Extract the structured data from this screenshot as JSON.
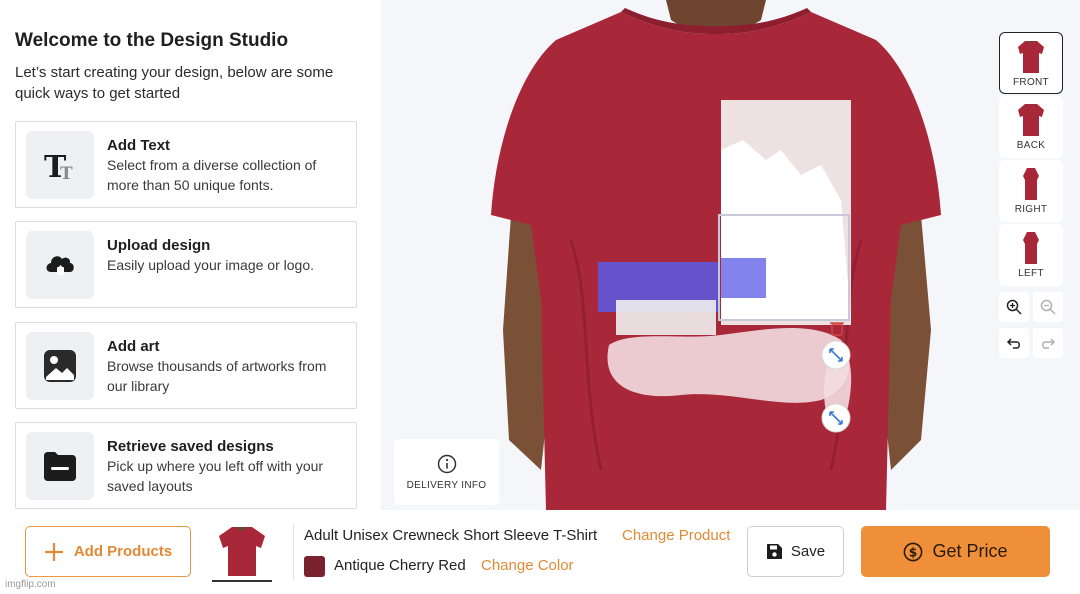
{
  "welcome": {
    "title": "Welcome to the Design Studio",
    "subtitle": "Let’s start creating your design, below are some quick ways to get started"
  },
  "options": [
    {
      "title": "Add Text",
      "description": "Select from a diverse collection of more than 50 unique fonts.",
      "icon": "text-icon"
    },
    {
      "title": "Upload design",
      "description": "Easily upload your image or logo.",
      "icon": "cloud-upload-icon"
    },
    {
      "title": "Add art",
      "description": "Browse thousands of artworks from our library",
      "icon": "image-icon"
    },
    {
      "title": "Retrieve saved designs",
      "description": "Pick up where you left off with your saved layouts",
      "icon": "folder-icon"
    }
  ],
  "views": {
    "front": "FRONT",
    "back": "BACK",
    "right": "RIGHT",
    "left": "LEFT"
  },
  "delivery_info": "DELIVERY INFO",
  "bottom": {
    "add_products": "Add Products",
    "product_name": "Adult Unisex Crewneck Short Sleeve T-Shirt",
    "change_product": "Change Product",
    "color_name": "Antique Cherry Red",
    "change_color": "Change Color",
    "save": "Save",
    "get_price": "Get Price"
  },
  "watermark": "imgflip.com",
  "colors": {
    "accent": "#ef8f3a",
    "accent_text": "#e08a35",
    "shirt": "#a8283a",
    "swatch": "#7a2230",
    "panel_bg": "#f4f6f9"
  }
}
